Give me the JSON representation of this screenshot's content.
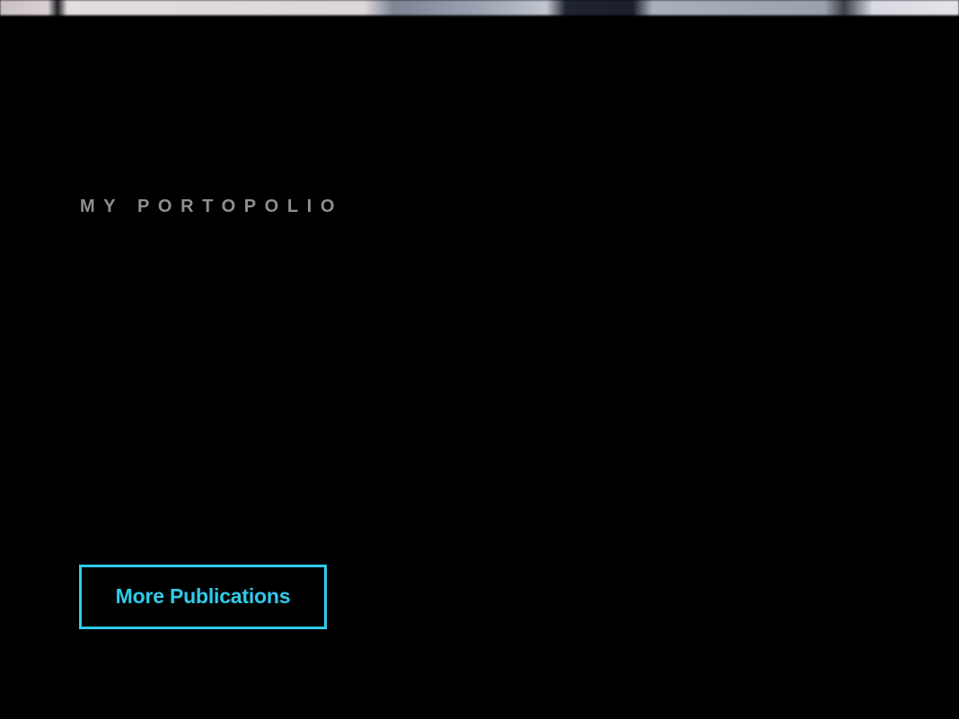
{
  "portfolio": {
    "title": "MY PORTOPOLIO",
    "more_button_label": "More Publications"
  },
  "colors": {
    "background": "#000000",
    "title_text": "#8f8f8f",
    "accent": "#2fcbeb"
  }
}
